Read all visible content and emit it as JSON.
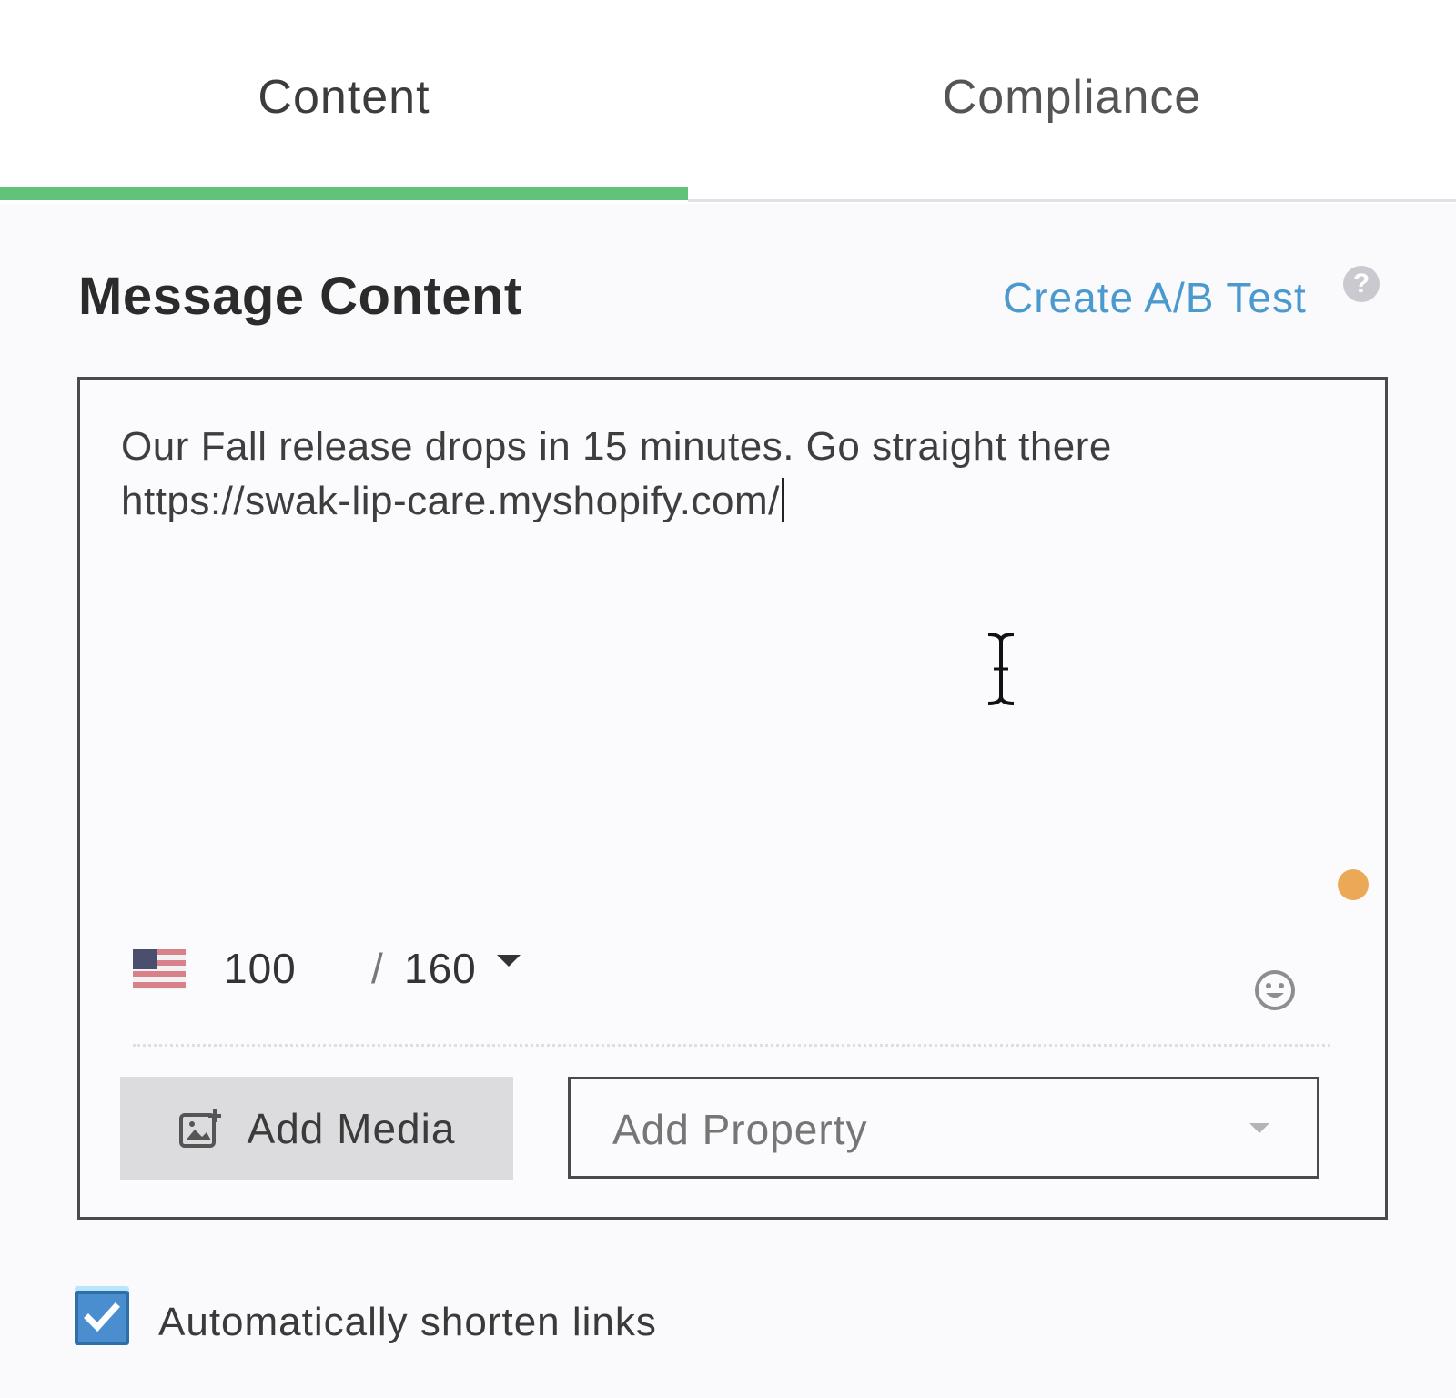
{
  "tabs": [
    {
      "label": "Content",
      "active": true
    },
    {
      "label": "Compliance",
      "active": false
    }
  ],
  "section": {
    "title": "Message Content",
    "ab_test_link": "Create A/B Test",
    "help_icon_glyph": "?"
  },
  "editor": {
    "message": "Our Fall release drops in 15 minutes. Go straight there https://swak-lip-care.myshopify.com/",
    "char_count": "100",
    "separator": "/",
    "char_limit": "160",
    "locale_flag": "us-flag-icon",
    "emoji_icon": "smiley-icon",
    "add_media_label": "Add Media",
    "add_property_placeholder": "Add Property"
  },
  "options": {
    "shorten_links_label": "Automatically shorten links",
    "shorten_links_checked": true
  },
  "colors": {
    "active_tab_underline": "#63c27a",
    "link": "#4a9ad0",
    "status_dot": "#eba957",
    "checkbox": "#4a8ed0"
  }
}
